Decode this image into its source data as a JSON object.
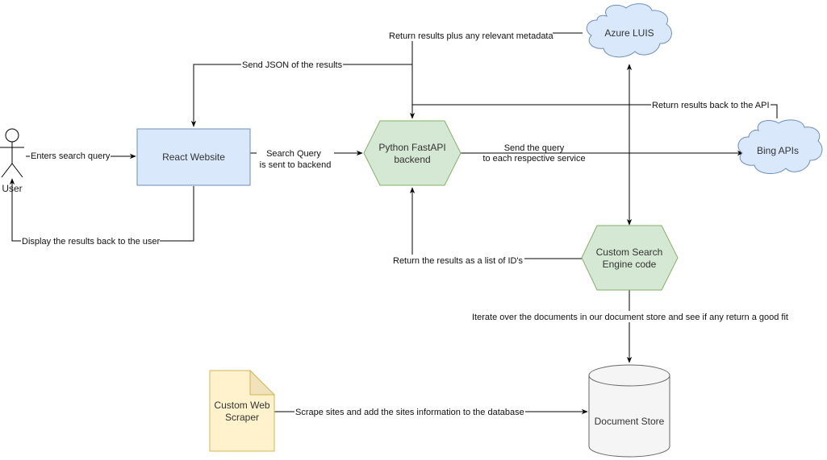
{
  "diagram": {
    "colors": {
      "blue_fill": "#dae8fc",
      "blue_stroke": "#6c8ebf",
      "green_fill": "#d5e8d4",
      "green_stroke": "#82b366",
      "yellow_fill": "#fff2cc",
      "yellow_stroke": "#d6b656",
      "gray_fill": "#f5f5f5",
      "gray_stroke": "#666666",
      "edge": "#000000"
    },
    "nodes": {
      "user": {
        "label": "User",
        "shape": "actor"
      },
      "react": {
        "label": "React Website",
        "shape": "rectangle"
      },
      "fastapi": {
        "line1": "Python FastAPI",
        "line2": "backend",
        "shape": "hexagon"
      },
      "azure": {
        "label": "Azure LUIS",
        "shape": "cloud"
      },
      "bing": {
        "label": "Bing APIs",
        "shape": "cloud"
      },
      "custom_engine": {
        "line1": "Custom Search",
        "line2": "Engine code",
        "shape": "hexagon"
      },
      "document_store": {
        "label": "Document Store",
        "shape": "cylinder"
      },
      "scraper": {
        "line1": "Custom Web",
        "line2": "Scraper",
        "shape": "note"
      }
    },
    "edges": {
      "enters_query": "Enters search query",
      "search_query_line1": "Search Query",
      "search_query_line2": "is sent to backend",
      "send_json": "Send JSON of the results",
      "return_metadata": "Return results plus any relevant metadata",
      "return_api": "Return results back to the API",
      "send_query_line1": "Send the query",
      "send_query_line2": "to each respective service",
      "return_ids": "Return the results as a list of ID's",
      "iterate": "Iterate over the documents in our document store and see if any return a good fit",
      "scrape": "Scrape sites and add the sites information to the database",
      "display_results": "Display the results back to the user"
    }
  }
}
